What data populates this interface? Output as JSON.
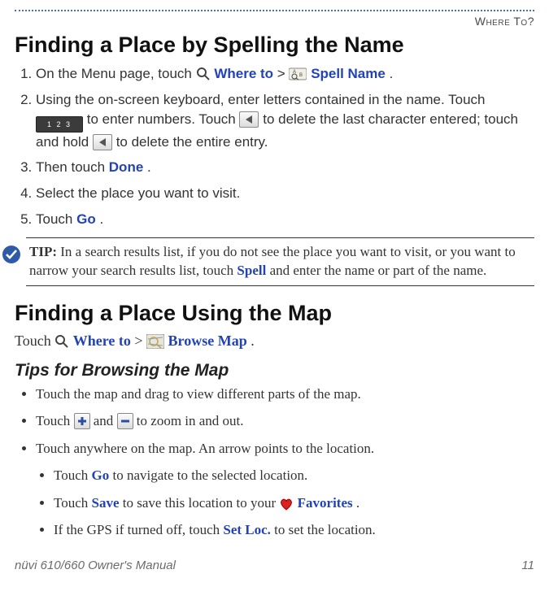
{
  "runhead": "Where To?",
  "h1a": "Finding a Place by Spelling the Name",
  "list1": {
    "i1a": "On the Menu page, touch ",
    "i1b": " Where to",
    "i1c": " > ",
    "i1d": " Spell Name",
    "i1e": ".",
    "i2a": "Using the on-screen keyboard, enter letters contained in the name. Touch ",
    "i2b": " to enter numbers. Touch ",
    "i2c": " to delete the last character entered; touch and hold ",
    "i2d": " to delete the entire entry.",
    "i3a": "Then touch ",
    "i3b": "Done",
    "i3c": ".",
    "i4": "Select the place you want to visit.",
    "i5a": "Touch ",
    "i5b": "Go",
    "i5c": "."
  },
  "tip": {
    "label": "TIP:",
    "a": " In a search results list, if you do not see the place you want to visit, or you want to narrow your search results list, touch ",
    "b": "Spell",
    "c": " and enter the name or part of the name."
  },
  "h1b": "Finding a Place Using the Map",
  "para2": {
    "a": "Touch ",
    "b": " Where to",
    "c": " > ",
    "d": " Browse Map",
    "e": "."
  },
  "h2": "Tips for Browsing the Map",
  "bul": {
    "b1": "Touch the map and drag to view different parts of the map.",
    "b2a": "Touch  ",
    "b2b": " and ",
    "b2c": " to zoom in and out.",
    "b3": "Touch anywhere on the map. An arrow points to the location.",
    "s1a": "Touch ",
    "s1b": "Go",
    "s1c": " to navigate to the selected location.",
    "s2a": "Touch ",
    "s2b": "Save",
    "s2c": " to save this location to your ",
    "s2d": " Favorites",
    "s2e": ".",
    "s3a": "If the GPS if turned off, touch ",
    "s3b": "Set Loc.",
    "s3c": " to set the location."
  },
  "footer": {
    "left": "nüvi 610/660 Owner's Manual",
    "right": "11"
  },
  "btn123": "1 2 3"
}
